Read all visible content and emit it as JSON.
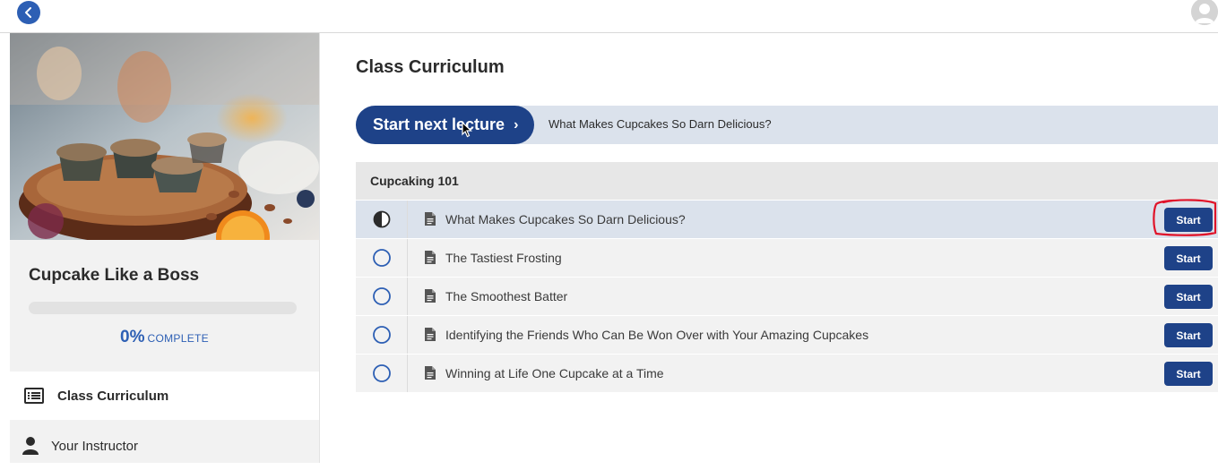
{
  "sidebar": {
    "course_title": "Cupcake Like a Boss",
    "progress": {
      "percent_label": "0%",
      "word": "COMPLETE",
      "value": 0
    },
    "nav": [
      {
        "label": "Class Curriculum",
        "icon": "list-icon",
        "active": true
      },
      {
        "label": "Your Instructor",
        "icon": "person-icon",
        "active": false
      }
    ]
  },
  "main": {
    "title": "Class Curriculum",
    "next_lecture": {
      "button_label": "Start next lecture",
      "chevron": "›",
      "lecture_title": "What Makes Cupcakes So Darn Delicious?"
    },
    "section": {
      "title": "Cupcaking 101",
      "lectures": [
        {
          "title": "What Makes Cupcakes So Darn Delicious?",
          "status": "in-progress",
          "action": "Start"
        },
        {
          "title": "The Tastiest Frosting",
          "status": "not-started",
          "action": "Start"
        },
        {
          "title": "The Smoothest Batter",
          "status": "not-started",
          "action": "Start"
        },
        {
          "title": "Identifying the Friends Who Can Be Won Over with Your Amazing Cupcakes",
          "status": "not-started",
          "action": "Start"
        },
        {
          "title": "Winning at Life One Cupcake at a Time",
          "status": "not-started",
          "action": "Start"
        }
      ]
    }
  },
  "colors": {
    "accent": "#1e4288",
    "accent_light": "#2d5fb4",
    "highlight_bar": "#dbe2ec",
    "annotation": "#e0142a"
  }
}
